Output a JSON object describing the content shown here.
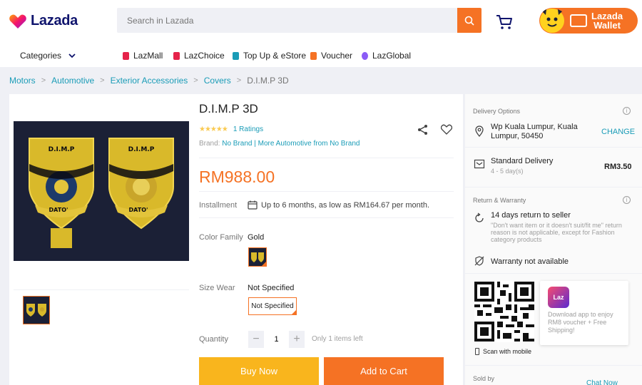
{
  "header": {
    "logo_text": "Lazada",
    "search_placeholder": "Search in Lazada",
    "wallet_line1": "Lazada",
    "wallet_line2": "Wallet"
  },
  "nav": {
    "categories_label": "Categories",
    "links": [
      {
        "label": "LazMall",
        "color": "#e5234a"
      },
      {
        "label": "LazChoice",
        "color": "#e5234a"
      },
      {
        "label": "Top Up & eStore",
        "color": "#1a9cb7"
      },
      {
        "label": "Voucher",
        "color": "#f57224"
      },
      {
        "label": "LazGlobal",
        "color": "#8b5cf6"
      }
    ]
  },
  "breadcrumb": [
    "Motors",
    "Automotive",
    "Exterior Accessories",
    "Covers",
    "D.I.M.P 3D"
  ],
  "product": {
    "title": "D.I.M.P 3D",
    "stars": "★★★★★",
    "rating_value": 5,
    "ratings_text": "1 Ratings",
    "brand_prefix": "Brand:",
    "brand_name": "No Brand",
    "brand_more": "| More Automotive from No Brand",
    "price": "RM988.00",
    "installment_label": "Installment",
    "installment_text": "Up to 6 months, as low as RM164.67 per month.",
    "color_label": "Color Family",
    "color_value": "Gold",
    "size_label": "Size Wear",
    "size_value": "Not Specified",
    "size_option": "Not Specified",
    "quantity_label": "Quantity",
    "quantity_minus": "−",
    "quantity_plus": "+",
    "quantity_value": "1",
    "stock_note": "Only 1 items left",
    "buy_now": "Buy Now",
    "add_to_cart": "Add to Cart"
  },
  "delivery": {
    "heading": "Delivery Options",
    "location": "Wp Kuala Lumpur, Kuala Lumpur, 50450",
    "change_label": "CHANGE",
    "method": "Standard Delivery",
    "eta": "4 - 5 day(s)",
    "fee": "RM3.50"
  },
  "warranty": {
    "heading": "Return & Warranty",
    "return_title": "14 days return to seller",
    "return_note": "\"Don't want item or it doesn't suit/fit me\" return reason is not applicable, except for Fashion category products",
    "warranty_text": "Warranty not available"
  },
  "app_promo": {
    "scan_label": "Scan with mobile",
    "app_logo": "Laz",
    "text": "Download app to enjoy RM8 voucher + Free Shipping!"
  },
  "seller": {
    "sold_by_label": "Sold by",
    "chat_label": "Chat Now"
  },
  "info_icon": "i",
  "colors": {
    "accent": "#f57224",
    "link": "#1a9cb7",
    "buy_now": "#f9b51d",
    "star": "#faca51"
  }
}
